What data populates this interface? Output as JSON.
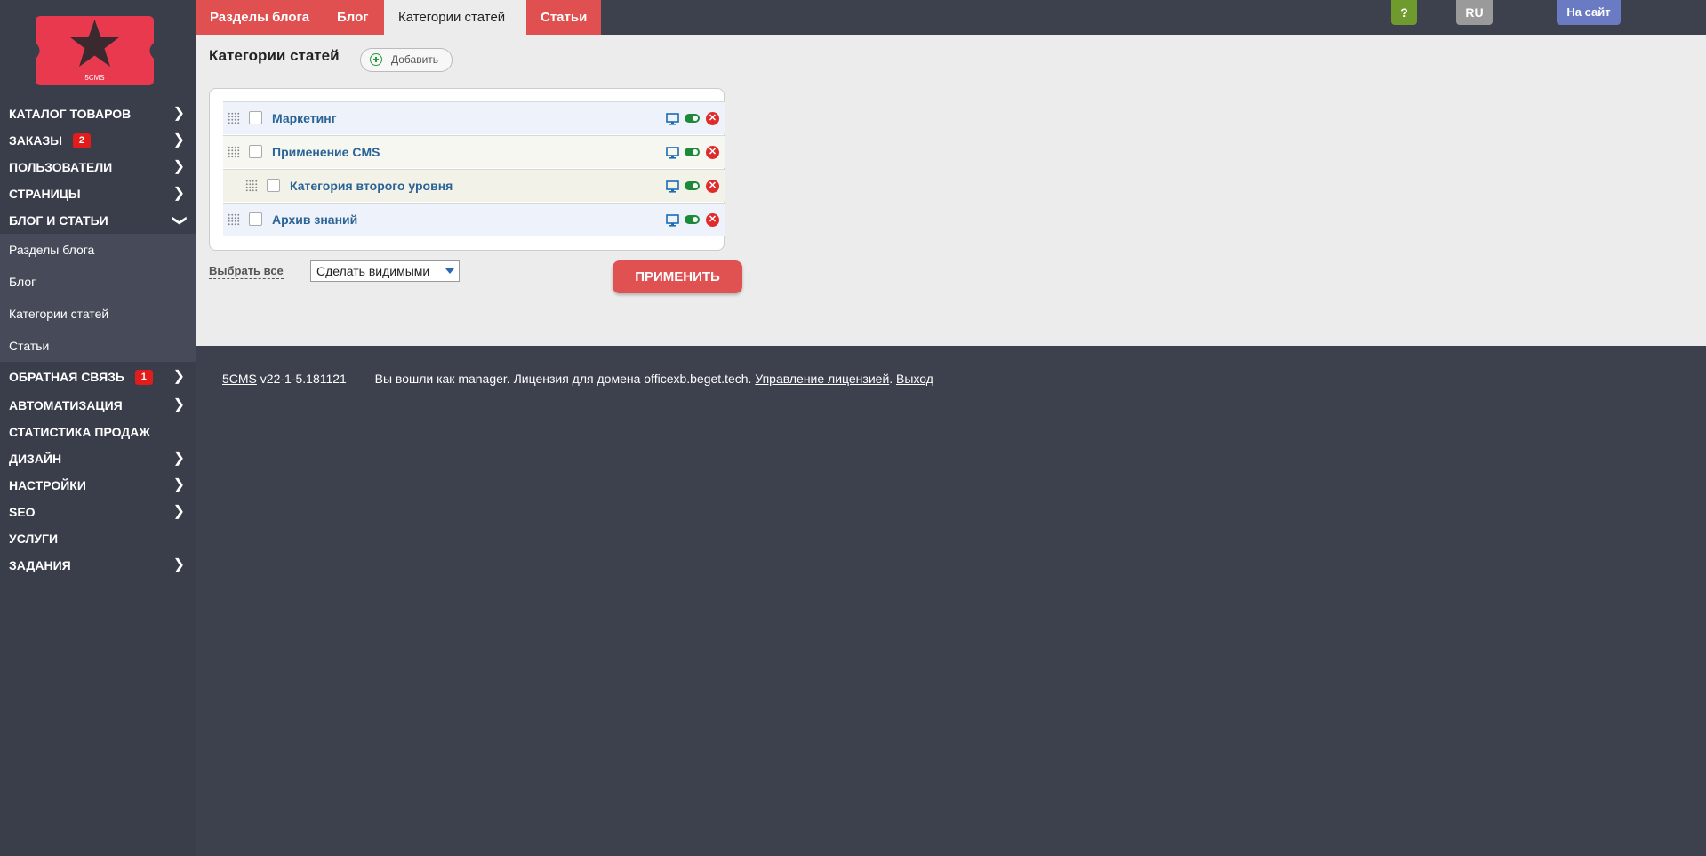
{
  "sidebar": {
    "logo_text": "5CMS",
    "menu": [
      {
        "label": "КАТАЛОГ ТОВАРОВ",
        "chevron": "right"
      },
      {
        "label": "ЗАКАЗЫ",
        "badge": "2",
        "chevron": "right"
      },
      {
        "label": "ПОЛЬЗОВАТЕЛИ",
        "chevron": "right"
      },
      {
        "label": "СТРАНИЦЫ",
        "chevron": "right"
      },
      {
        "label": "БЛОГ И СТАТЬИ",
        "chevron": "down"
      }
    ],
    "submenu": [
      "Разделы блога",
      "Блог",
      "Категории статей",
      "Статьи"
    ],
    "menu_after": [
      {
        "label": "ОБРАТНАЯ СВЯЗЬ",
        "badge": "1",
        "chevron": "right"
      },
      {
        "label": "АВТОМАТИЗАЦИЯ",
        "chevron": "right"
      },
      {
        "label": "СТАТИСТИКА ПРОДАЖ",
        "chevron": ""
      },
      {
        "label": "ДИЗАЙН",
        "chevron": "right"
      },
      {
        "label": "НАСТРОЙКИ",
        "chevron": "right"
      },
      {
        "label": "SEO",
        "chevron": "right"
      },
      {
        "label": "УСЛУГИ",
        "chevron": ""
      },
      {
        "label": "ЗАДАНИЯ",
        "chevron": "right"
      }
    ]
  },
  "tabs": [
    "Разделы блога",
    "Блог",
    "Категории статей",
    "Статьи"
  ],
  "active_tab": "Категории статей",
  "topbar": {
    "help_label": "?",
    "lang_label": "RU",
    "site_label": "На сайт"
  },
  "main": {
    "title": "Категории статей",
    "add_label": "Добавить",
    "rows": [
      {
        "label": "Маркетинг",
        "level": 1,
        "visible": true,
        "enabled": true
      },
      {
        "label": "Применение CMS",
        "level": 1,
        "visible": true,
        "enabled": true
      },
      {
        "label": "Категория второго уровня",
        "level": 2,
        "visible": true,
        "enabled": true
      },
      {
        "label": "Архив знаний",
        "level": 1,
        "visible": true,
        "enabled": true
      }
    ],
    "select_all_label": "Выбрать все",
    "action_value": "Сделать видимыми",
    "apply_label": "ПРИМЕНИТЬ"
  },
  "footer": {
    "brand": "5CMS",
    "version": "v22-1-5.181121",
    "login_text": "Вы вошли как manager. Лицензия для домена officexb.beget.tech.",
    "license_link": "Управление лицензией",
    "sep": ".",
    "logout_link": "Выход"
  },
  "colors": {
    "accent": "#e05050",
    "sidebar_bg": "#3a3d4a",
    "link": "#2a6496",
    "help_btn": "#6f9a2e",
    "lang_btn": "#9a9a9a",
    "site_btn": "#6a7bc4"
  }
}
